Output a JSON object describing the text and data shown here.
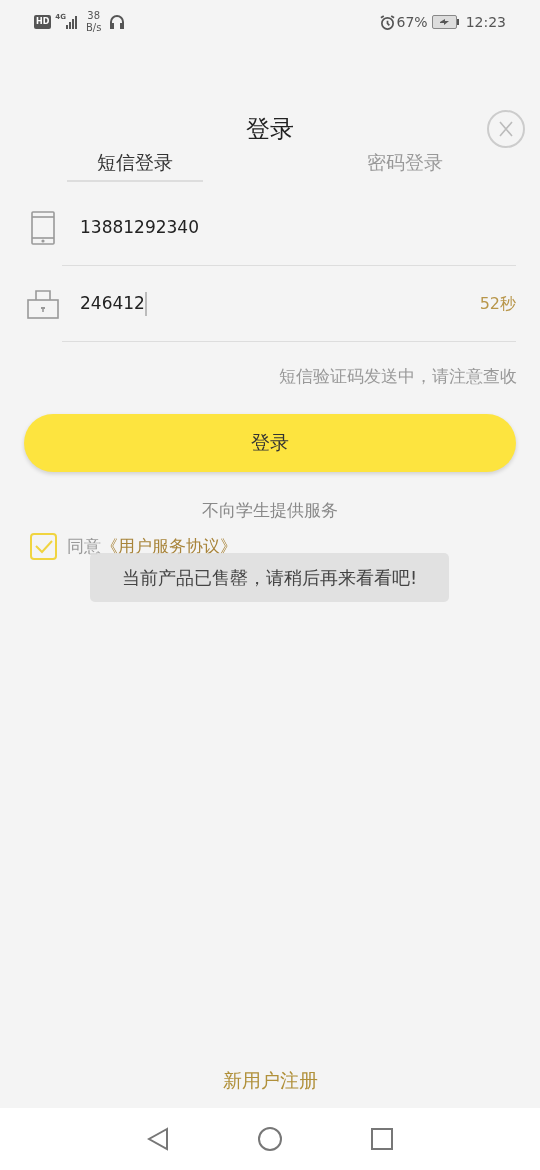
{
  "status_bar": {
    "hd": "HD",
    "network": "4G",
    "speed_value": "38",
    "speed_unit": "B/s",
    "battery": "67%",
    "time": "12:23"
  },
  "title": "登录",
  "tabs": [
    {
      "label": "短信登录",
      "selected": true
    },
    {
      "label": "密码登录",
      "selected": false
    }
  ],
  "fields": [
    {
      "kind": "phone",
      "value": "13881292340"
    },
    {
      "kind": "code",
      "value": "246412",
      "countdown": "52秒"
    }
  ],
  "hint": "短信验证码发送中，请注意查收",
  "login_button": "登录",
  "notice": "不向学生提供服务",
  "agreement": {
    "checked": true,
    "prefix": "同意",
    "link": "《用户服务协议》"
  },
  "toast": "当前产品已售罄，请稍后再来看看吧!",
  "register_link": "新用户注册"
}
